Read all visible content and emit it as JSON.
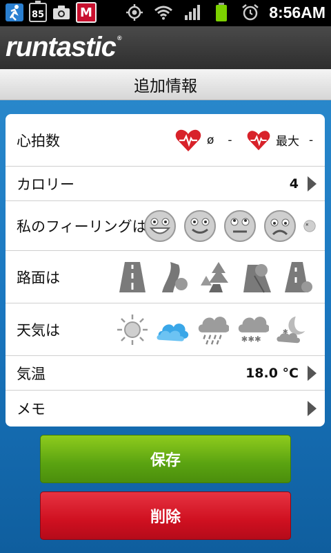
{
  "status_bar": {
    "battery_badge": "85",
    "time": "8:56AM",
    "icons": [
      "runner-icon",
      "battery-badge-icon",
      "camera-icon",
      "mcafee-icon",
      "gps-icon",
      "wifi-icon",
      "signal-icon",
      "battery-icon",
      "alarm-icon"
    ]
  },
  "app": {
    "logo": "runtastic",
    "trademark": "®"
  },
  "title": "追加情報",
  "rows": {
    "heart_rate": {
      "label": "心拍数",
      "avg_symbol": "ø",
      "avg_value": "-",
      "max_label": "最大",
      "max_value": "-"
    },
    "calories": {
      "label": "カロリー",
      "value": "4"
    },
    "feeling": {
      "label": "私のフィーリングは",
      "options": [
        "very-happy-face-icon",
        "happy-face-icon",
        "neutral-face-icon",
        "sad-face-icon",
        "crossed-face-icon"
      ]
    },
    "surface": {
      "label": "路面は",
      "options": [
        "road-icon",
        "trail-icon",
        "forest-icon",
        "offroad-icon",
        "mixed-road-icon"
      ]
    },
    "weather": {
      "label": "天気は",
      "options": [
        "sunny-icon",
        "cloudy-icon",
        "rainy-icon",
        "snowy-icon",
        "night-icon"
      ],
      "selected": "cloudy-icon"
    },
    "temperature": {
      "label": "気温",
      "value": "18.0 °C"
    },
    "memo": {
      "label": "メモ"
    }
  },
  "buttons": {
    "save": "保存",
    "delete": "削除"
  },
  "colors": {
    "save": "#5aa311",
    "delete": "#cf1020",
    "heart": "#d8222a",
    "selected_weather": "#3aa7e8"
  }
}
